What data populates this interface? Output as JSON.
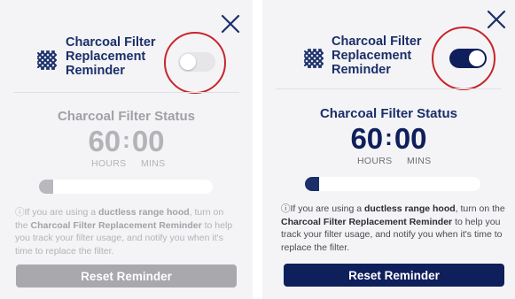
{
  "colors": {
    "brand_navy": "#0f1f5c",
    "title_navy": "#1b2f69",
    "disabled_gray": "#a8a8ad",
    "highlight_red": "#c8252b"
  },
  "icons": {
    "close": "close-icon",
    "filter": "charcoal-filter-icon",
    "info": "info-icon"
  },
  "left": {
    "title": "Charcoal Filter\nReplacement\nReminder",
    "toggle_on": false,
    "status_title": "Charcoal Filter Status",
    "hours": "60",
    "mins": "00",
    "colon": ":",
    "hours_label": "HOURS",
    "mins_label": "MINS",
    "progress": 0.08,
    "info": {
      "icon_glyph": "ⓘ",
      "t1": "If you are using a ",
      "b1": "ductless range hood",
      "t2": ", turn on the ",
      "b2": "Charcoal Filter Replacement Reminder",
      "t3": " to help you track your filter usage, and notify you when it's time to replace the filter."
    },
    "reset_label": "Reset Reminder"
  },
  "right": {
    "title": "Charcoal Filter\nReplacement\nReminder",
    "toggle_on": true,
    "status_title": "Charcoal Filter Status",
    "hours": "60",
    "mins": "00",
    "colon": ":",
    "hours_label": "HOURS",
    "mins_label": "MINS",
    "progress": 0.08,
    "info": {
      "icon_glyph": "ⓘ",
      "t1": "If you are using a ",
      "b1": "ductless range hood",
      "t2": ", turn on the ",
      "b2": "Charcoal Filter Replacement Reminder",
      "t3": " to help you track your filter usage, and notify you when it's time to replace the filter."
    },
    "reset_label": "Reset Reminder"
  }
}
